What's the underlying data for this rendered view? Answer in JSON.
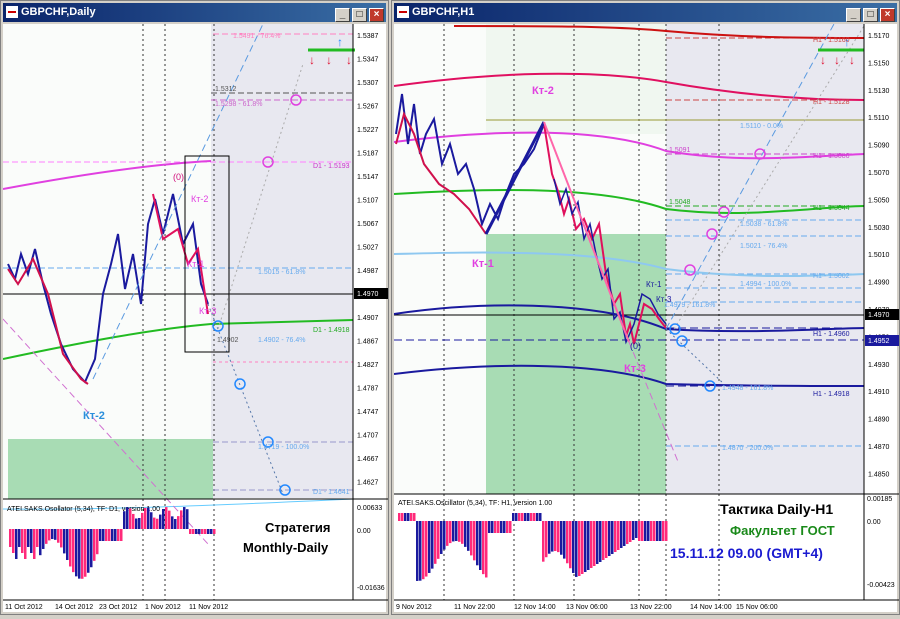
{
  "left_window": {
    "title": "GBPCHF,Daily",
    "buttons": {
      "minimize": "_",
      "maximize": "□",
      "close": "×"
    },
    "price_scale": [
      "1.5387",
      "1.5347",
      "1.5307",
      "1.5267",
      "1.5227",
      "1.5187",
      "1.5147",
      "1.5107",
      "1.5067",
      "1.5027",
      "1.4987",
      "1.4947",
      "1.4907",
      "1.4867",
      "1.4827",
      "1.4787",
      "1.4747",
      "1.4707",
      "1.4667",
      "1.4627"
    ],
    "current_price": "1.4970",
    "date_labels": [
      "11 Oct 2012",
      "14 Oct 2012",
      "23 Oct 2012",
      "1 Nov 2012",
      "11 Nov 2012"
    ],
    "level_labels": [
      "1.5312",
      "1.5298 - 61.8%",
      "1.5491 - 76.4%",
      "D1 - 1.5193",
      "1.5015 - 61.8%",
      "D1 - 1.4918",
      "1.4902",
      "1.4902 - 76.4%",
      "1.4719 - 100.0%",
      "D1 - 1.4641"
    ],
    "wave_labels": [
      "(0)",
      "Кт-2",
      "Кт-1",
      "Кт-3",
      "Кт-2"
    ],
    "oscillator": {
      "title": "ATEI.SAKS.Osollator (5,34), TF: D1, version 1.00",
      "max": "0.00633",
      "zero": "0.00",
      "min": "-0.01636"
    },
    "strategy_text": [
      "Стратегия",
      "Monthly-Daily"
    ]
  },
  "right_window": {
    "title": "GBPCHF,H1",
    "buttons": {
      "minimize": "_",
      "maximize": "□",
      "close": "×"
    },
    "price_scale": [
      "1.5170",
      "1.5150",
      "1.5130",
      "1.5110",
      "1.5090",
      "1.5070",
      "1.5050",
      "1.5030",
      "1.5010",
      "1.4990",
      "1.4970",
      "1.4950",
      "1.4930",
      "1.4910",
      "1.4890",
      "1.4870",
      "1.4850"
    ],
    "current_price": "1.4970",
    "second_price": "1.4952",
    "date_labels": [
      "9 Nov 2012",
      "11 Nov 22:00",
      "12 Nov 14:00",
      "13 Nov 06:00",
      "13 Nov 22:00",
      "14 Nov 14:00",
      "15 Nov 06:00"
    ],
    "level_labels": [
      "H1 - 1.5160",
      "H1 - 1.5128",
      "1.5110 - 0.0%",
      "1.5091",
      "H1 - 1.5086",
      "1.5048",
      "1.5038 - 61.8%",
      "H1 - 1.5044",
      "1.5021 - 76.4%",
      "H1 - 1.5002",
      "1.4994 - 100.0%",
      "1.4979 - 161.8%",
      "H1 - 1.4960",
      "1.4948 - 161.8%",
      "H1 - 1.4918",
      "1.4870 - 200.0%"
    ],
    "wave_labels": [
      "Кт-2",
      "Кт-1",
      "(0)",
      "Кт-3",
      "Кт-1",
      "Кт-3"
    ],
    "oscillator": {
      "title": "ATEI.SAKS.Oscillator (5,34), TF: H1, version 1.00",
      "max": "0.00185",
      "zero": "0.00",
      "min": "-0.00423"
    },
    "tactic_title": "Тактика Daily-H1",
    "faculty": "Факультет ГОСТ",
    "datetime": "15.11.12   09.00 (GMT+4)"
  }
}
